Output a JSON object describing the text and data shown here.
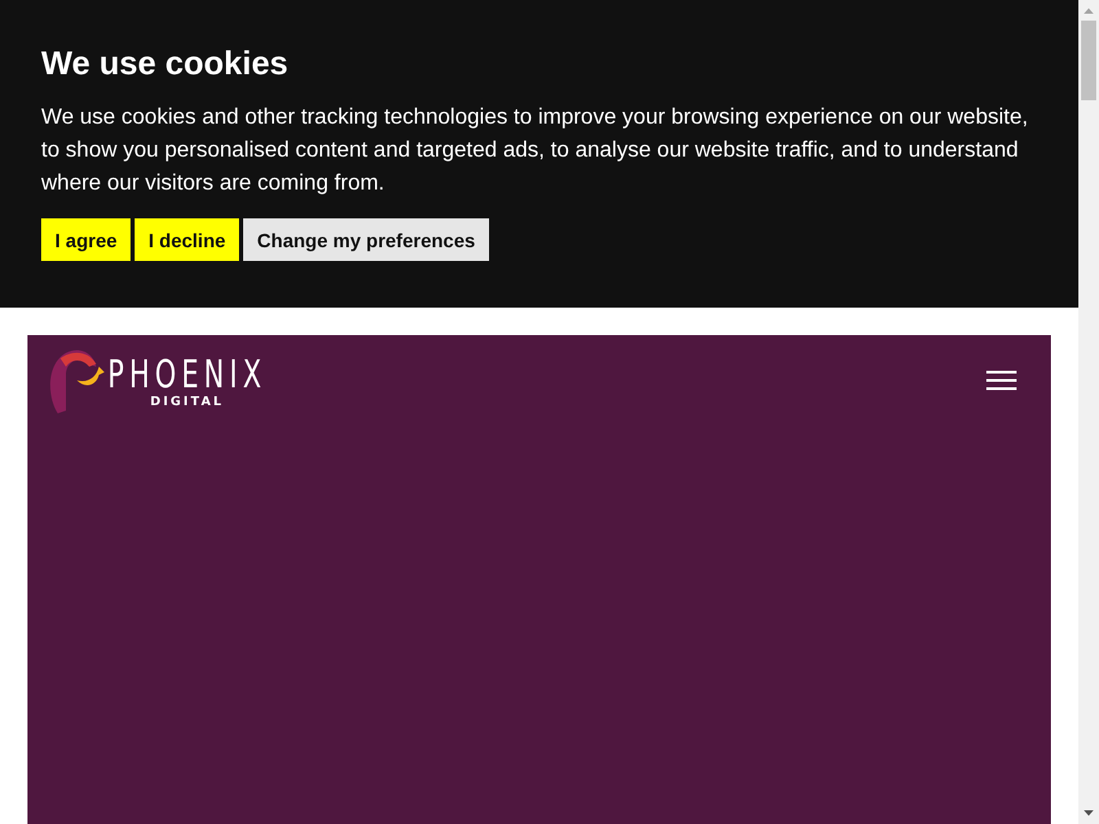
{
  "cookie_banner": {
    "title": "We use cookies",
    "message": "We use cookies and other tracking technologies to improve your browsing experience on our website, to show you personalised content and targeted ads, to analyse our website traffic, and to understand where our visitors are coming from.",
    "buttons": [
      {
        "label": "I agree",
        "kind": "primary"
      },
      {
        "label": "I decline",
        "kind": "primary"
      },
      {
        "label": "Change my preferences",
        "kind": "secondary"
      }
    ]
  },
  "header": {
    "logo": {
      "name": "PHOENIX",
      "tagline": "DIGITAL"
    }
  }
}
